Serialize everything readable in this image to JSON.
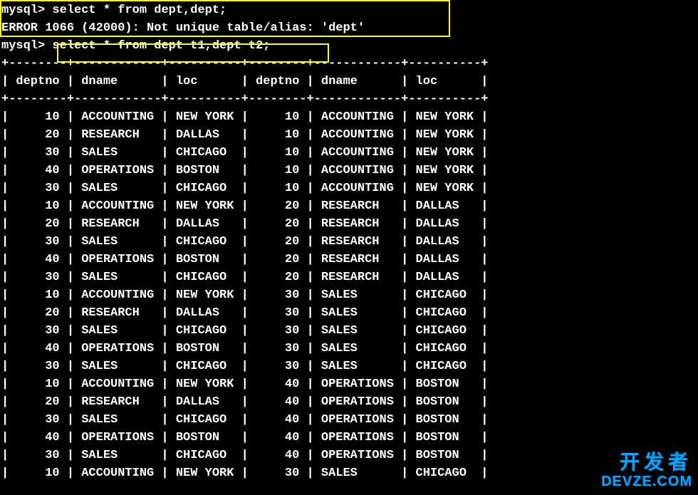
{
  "prompt": "mysql>",
  "query1": "select * from dept,dept;",
  "error": "ERROR 1066 (42000): Not unique table/alias: 'dept'",
  "query2": "select * from dept t1,dept t2;",
  "columns": [
    "deptno",
    "dname",
    "loc",
    "deptno",
    "dname",
    "loc"
  ],
  "rows": [
    [
      "10",
      "ACCOUNTING",
      "NEW YORK",
      "10",
      "ACCOUNTING",
      "NEW YORK"
    ],
    [
      "20",
      "RESEARCH",
      "DALLAS",
      "10",
      "ACCOUNTING",
      "NEW YORK"
    ],
    [
      "30",
      "SALES",
      "CHICAGO",
      "10",
      "ACCOUNTING",
      "NEW YORK"
    ],
    [
      "40",
      "OPERATIONS",
      "BOSTON",
      "10",
      "ACCOUNTING",
      "NEW YORK"
    ],
    [
      "30",
      "SALES",
      "CHICAGO",
      "10",
      "ACCOUNTING",
      "NEW YORK"
    ],
    [
      "10",
      "ACCOUNTING",
      "NEW YORK",
      "20",
      "RESEARCH",
      "DALLAS"
    ],
    [
      "20",
      "RESEARCH",
      "DALLAS",
      "20",
      "RESEARCH",
      "DALLAS"
    ],
    [
      "30",
      "SALES",
      "CHICAGO",
      "20",
      "RESEARCH",
      "DALLAS"
    ],
    [
      "40",
      "OPERATIONS",
      "BOSTON",
      "20",
      "RESEARCH",
      "DALLAS"
    ],
    [
      "30",
      "SALES",
      "CHICAGO",
      "20",
      "RESEARCH",
      "DALLAS"
    ],
    [
      "10",
      "ACCOUNTING",
      "NEW YORK",
      "30",
      "SALES",
      "CHICAGO"
    ],
    [
      "20",
      "RESEARCH",
      "DALLAS",
      "30",
      "SALES",
      "CHICAGO"
    ],
    [
      "30",
      "SALES",
      "CHICAGO",
      "30",
      "SALES",
      "CHICAGO"
    ],
    [
      "40",
      "OPERATIONS",
      "BOSTON",
      "30",
      "SALES",
      "CHICAGO"
    ],
    [
      "30",
      "SALES",
      "CHICAGO",
      "30",
      "SALES",
      "CHICAGO"
    ],
    [
      "10",
      "ACCOUNTING",
      "NEW YORK",
      "40",
      "OPERATIONS",
      "BOSTON"
    ],
    [
      "20",
      "RESEARCH",
      "DALLAS",
      "40",
      "OPERATIONS",
      "BOSTON"
    ],
    [
      "30",
      "SALES",
      "CHICAGO",
      "40",
      "OPERATIONS",
      "BOSTON"
    ],
    [
      "40",
      "OPERATIONS",
      "BOSTON",
      "40",
      "OPERATIONS",
      "BOSTON"
    ],
    [
      "30",
      "SALES",
      "CHICAGO",
      "40",
      "OPERATIONS",
      "BOSTON"
    ],
    [
      "10",
      "ACCOUNTING",
      "NEW YORK",
      "30",
      "SALES",
      "CHICAGO"
    ]
  ],
  "watermark": {
    "line1": "开发者",
    "line2": "DEVZE.COM"
  }
}
